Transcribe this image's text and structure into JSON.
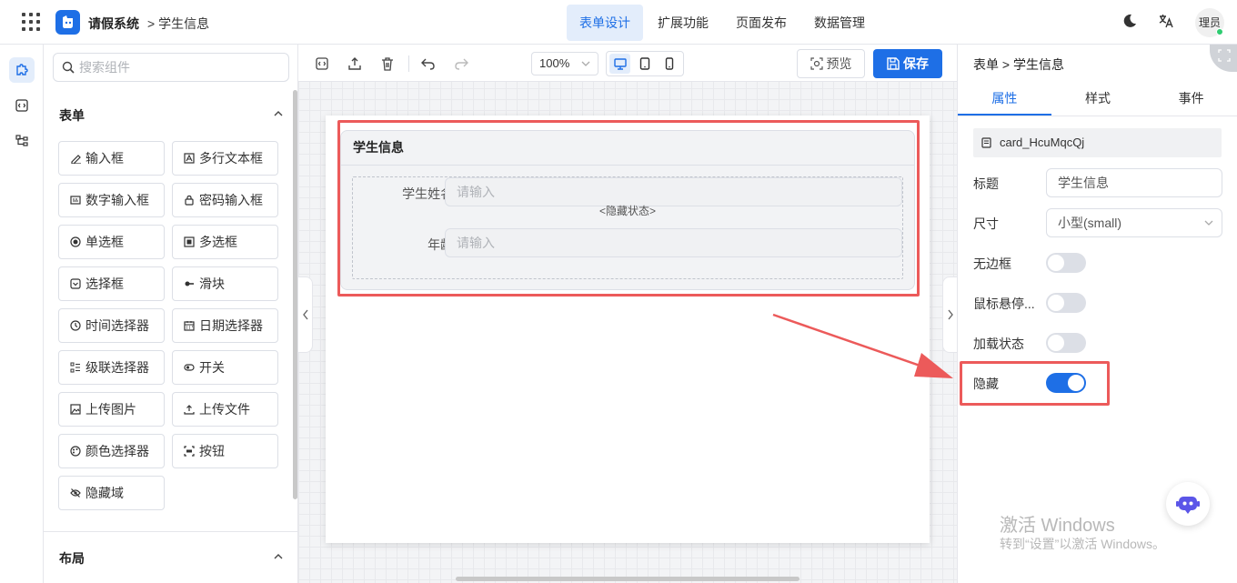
{
  "header": {
    "app_title": "请假系统",
    "breadcrumb": "学生信息",
    "tabs": [
      "表单设计",
      "扩展功能",
      "页面发布",
      "数据管理"
    ],
    "active_tab": "表单设计",
    "user": "理员"
  },
  "components": {
    "search_placeholder": "搜索组件",
    "section_form": "表单",
    "items": [
      {
        "label": "输入框",
        "icon": "pencil-icon"
      },
      {
        "label": "多行文本框",
        "icon": "textarea-icon"
      },
      {
        "label": "数字输入框",
        "icon": "number-icon"
      },
      {
        "label": "密码输入框",
        "icon": "lock-icon"
      },
      {
        "label": "单选框",
        "icon": "radio-icon"
      },
      {
        "label": "多选框",
        "icon": "checkbox-icon"
      },
      {
        "label": "选择框",
        "icon": "select-icon"
      },
      {
        "label": "滑块",
        "icon": "slider-icon"
      },
      {
        "label": "时间选择器",
        "icon": "clock-icon"
      },
      {
        "label": "日期选择器",
        "icon": "calendar-icon"
      },
      {
        "label": "级联选择器",
        "icon": "cascader-icon"
      },
      {
        "label": "开关",
        "icon": "switch-icon"
      },
      {
        "label": "上传图片",
        "icon": "image-icon"
      },
      {
        "label": "上传文件",
        "icon": "upload-icon"
      },
      {
        "label": "颜色选择器",
        "icon": "palette-icon"
      },
      {
        "label": "按钮",
        "icon": "button-icon"
      },
      {
        "label": "隐藏域",
        "icon": "eye-off-icon"
      }
    ],
    "section_layout": "布局"
  },
  "toolbar": {
    "zoom": "100%",
    "preview": "预览",
    "save": "保存"
  },
  "canvas": {
    "card_title": "学生信息",
    "hidden_tag": "<隐藏状态>",
    "fields": [
      {
        "label": "学生姓名:",
        "placeholder": "请输入"
      },
      {
        "label": "年龄:",
        "placeholder": "请输入"
      }
    ]
  },
  "props": {
    "breadcrumb": "表单 > 学生信息",
    "tabs": [
      "属性",
      "样式",
      "事件"
    ],
    "active_tab": "属性",
    "component_id": "card_HcuMqcQj",
    "title_label": "标题",
    "title_value": "学生信息",
    "size_label": "尺寸",
    "size_value": "小型(small)",
    "no_border_label": "无边框",
    "hover_label": "鼠标悬停...",
    "loading_label": "加载状态",
    "hidden_label": "隐藏",
    "switches": {
      "no_border": false,
      "hover": false,
      "loading": false,
      "hidden": true
    }
  },
  "watermark": {
    "line1": "激活 Windows",
    "line2": "转到“设置”以激活 Windows。"
  },
  "colors": {
    "accent": "#1e6fe6",
    "highlight": "#ec5a5a"
  }
}
